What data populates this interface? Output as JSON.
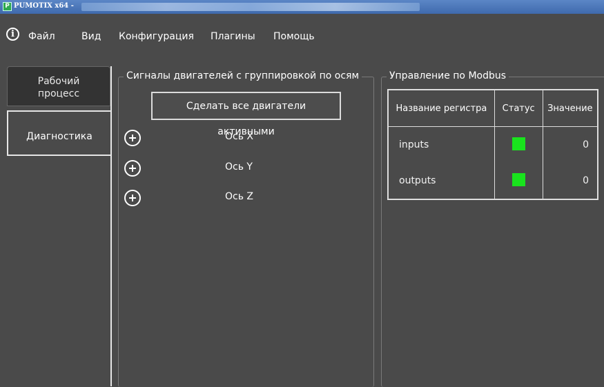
{
  "window": {
    "title": "PUMOTIX x64 -"
  },
  "menu": {
    "info_icon": "info-icon",
    "items": [
      "Файл",
      "Вид",
      "Конфигурация",
      "Плагины",
      "Помощь"
    ]
  },
  "tabs": [
    {
      "label": "Рабочий процесс",
      "active": false
    },
    {
      "label": "Диагностика",
      "active": true
    }
  ],
  "motors_group": {
    "title": "Сигналы двигателей с группировкой по осям",
    "activate_all_label": "Сделать все двигатели активными",
    "axes": [
      "Ось X",
      "Ось Y",
      "Ось Z"
    ]
  },
  "modbus_group": {
    "title": "Управление по Modbus",
    "columns": [
      "Название регистра",
      "Статус",
      "Значение"
    ],
    "rows": [
      {
        "name": "inputs",
        "status": "green",
        "value": "0"
      },
      {
        "name": "outputs",
        "status": "green",
        "value": "0"
      }
    ]
  },
  "colors": {
    "background": "#4a4a4a",
    "led_on": "#19e31d",
    "titlebar": "#4a78bb"
  }
}
